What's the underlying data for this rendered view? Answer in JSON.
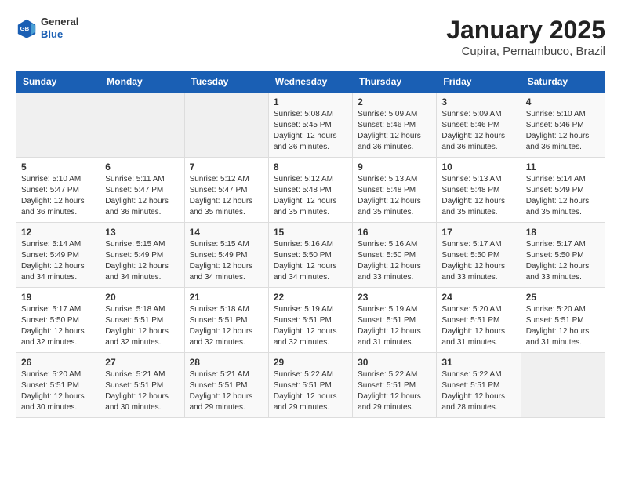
{
  "logo": {
    "general": "General",
    "blue": "Blue"
  },
  "header": {
    "month": "January 2025",
    "location": "Cupira, Pernambuco, Brazil"
  },
  "weekdays": [
    "Sunday",
    "Monday",
    "Tuesday",
    "Wednesday",
    "Thursday",
    "Friday",
    "Saturday"
  ],
  "weeks": [
    [
      {
        "day": "",
        "info": ""
      },
      {
        "day": "",
        "info": ""
      },
      {
        "day": "",
        "info": ""
      },
      {
        "day": "1",
        "info": "Sunrise: 5:08 AM\nSunset: 5:45 PM\nDaylight: 12 hours\nand 36 minutes."
      },
      {
        "day": "2",
        "info": "Sunrise: 5:09 AM\nSunset: 5:46 PM\nDaylight: 12 hours\nand 36 minutes."
      },
      {
        "day": "3",
        "info": "Sunrise: 5:09 AM\nSunset: 5:46 PM\nDaylight: 12 hours\nand 36 minutes."
      },
      {
        "day": "4",
        "info": "Sunrise: 5:10 AM\nSunset: 5:46 PM\nDaylight: 12 hours\nand 36 minutes."
      }
    ],
    [
      {
        "day": "5",
        "info": "Sunrise: 5:10 AM\nSunset: 5:47 PM\nDaylight: 12 hours\nand 36 minutes."
      },
      {
        "day": "6",
        "info": "Sunrise: 5:11 AM\nSunset: 5:47 PM\nDaylight: 12 hours\nand 36 minutes."
      },
      {
        "day": "7",
        "info": "Sunrise: 5:12 AM\nSunset: 5:47 PM\nDaylight: 12 hours\nand 35 minutes."
      },
      {
        "day": "8",
        "info": "Sunrise: 5:12 AM\nSunset: 5:48 PM\nDaylight: 12 hours\nand 35 minutes."
      },
      {
        "day": "9",
        "info": "Sunrise: 5:13 AM\nSunset: 5:48 PM\nDaylight: 12 hours\nand 35 minutes."
      },
      {
        "day": "10",
        "info": "Sunrise: 5:13 AM\nSunset: 5:48 PM\nDaylight: 12 hours\nand 35 minutes."
      },
      {
        "day": "11",
        "info": "Sunrise: 5:14 AM\nSunset: 5:49 PM\nDaylight: 12 hours\nand 35 minutes."
      }
    ],
    [
      {
        "day": "12",
        "info": "Sunrise: 5:14 AM\nSunset: 5:49 PM\nDaylight: 12 hours\nand 34 minutes."
      },
      {
        "day": "13",
        "info": "Sunrise: 5:15 AM\nSunset: 5:49 PM\nDaylight: 12 hours\nand 34 minutes."
      },
      {
        "day": "14",
        "info": "Sunrise: 5:15 AM\nSunset: 5:49 PM\nDaylight: 12 hours\nand 34 minutes."
      },
      {
        "day": "15",
        "info": "Sunrise: 5:16 AM\nSunset: 5:50 PM\nDaylight: 12 hours\nand 34 minutes."
      },
      {
        "day": "16",
        "info": "Sunrise: 5:16 AM\nSunset: 5:50 PM\nDaylight: 12 hours\nand 33 minutes."
      },
      {
        "day": "17",
        "info": "Sunrise: 5:17 AM\nSunset: 5:50 PM\nDaylight: 12 hours\nand 33 minutes."
      },
      {
        "day": "18",
        "info": "Sunrise: 5:17 AM\nSunset: 5:50 PM\nDaylight: 12 hours\nand 33 minutes."
      }
    ],
    [
      {
        "day": "19",
        "info": "Sunrise: 5:17 AM\nSunset: 5:50 PM\nDaylight: 12 hours\nand 32 minutes."
      },
      {
        "day": "20",
        "info": "Sunrise: 5:18 AM\nSunset: 5:51 PM\nDaylight: 12 hours\nand 32 minutes."
      },
      {
        "day": "21",
        "info": "Sunrise: 5:18 AM\nSunset: 5:51 PM\nDaylight: 12 hours\nand 32 minutes."
      },
      {
        "day": "22",
        "info": "Sunrise: 5:19 AM\nSunset: 5:51 PM\nDaylight: 12 hours\nand 32 minutes."
      },
      {
        "day": "23",
        "info": "Sunrise: 5:19 AM\nSunset: 5:51 PM\nDaylight: 12 hours\nand 31 minutes."
      },
      {
        "day": "24",
        "info": "Sunrise: 5:20 AM\nSunset: 5:51 PM\nDaylight: 12 hours\nand 31 minutes."
      },
      {
        "day": "25",
        "info": "Sunrise: 5:20 AM\nSunset: 5:51 PM\nDaylight: 12 hours\nand 31 minutes."
      }
    ],
    [
      {
        "day": "26",
        "info": "Sunrise: 5:20 AM\nSunset: 5:51 PM\nDaylight: 12 hours\nand 30 minutes."
      },
      {
        "day": "27",
        "info": "Sunrise: 5:21 AM\nSunset: 5:51 PM\nDaylight: 12 hours\nand 30 minutes."
      },
      {
        "day": "28",
        "info": "Sunrise: 5:21 AM\nSunset: 5:51 PM\nDaylight: 12 hours\nand 29 minutes."
      },
      {
        "day": "29",
        "info": "Sunrise: 5:22 AM\nSunset: 5:51 PM\nDaylight: 12 hours\nand 29 minutes."
      },
      {
        "day": "30",
        "info": "Sunrise: 5:22 AM\nSunset: 5:51 PM\nDaylight: 12 hours\nand 29 minutes."
      },
      {
        "day": "31",
        "info": "Sunrise: 5:22 AM\nSunset: 5:51 PM\nDaylight: 12 hours\nand 28 minutes."
      },
      {
        "day": "",
        "info": ""
      }
    ]
  ]
}
